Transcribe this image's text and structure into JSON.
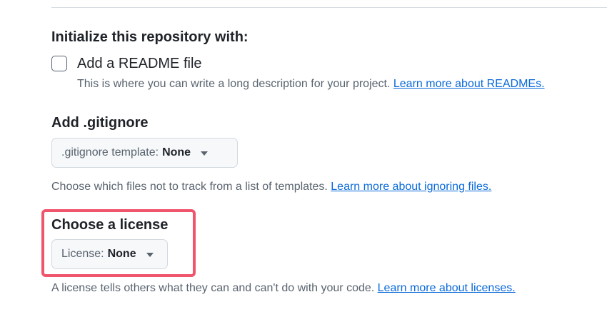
{
  "initialize": {
    "title": "Initialize this repository with:",
    "readme_label": "Add a README file",
    "readme_checked": false,
    "readme_help": "This is where you can write a long description for your project.",
    "readme_link": "Learn more about READMEs."
  },
  "gitignore": {
    "title": "Add .gitignore",
    "select_prefix": ".gitignore template:",
    "select_value": "None",
    "help": "Choose which files not to track from a list of templates.",
    "link": "Learn more about ignoring files."
  },
  "license": {
    "title": "Choose a license",
    "select_prefix": "License:",
    "select_value": "None",
    "help": "A license tells others what they can and can't do with your code.",
    "link": "Learn more about licenses."
  },
  "icons": {
    "dropdown": "triangle-down-icon"
  },
  "colors": {
    "link": "#0969da",
    "highlight": "#f0556e",
    "muted_text": "#59636e",
    "select_bg": "#f6f8fa"
  }
}
